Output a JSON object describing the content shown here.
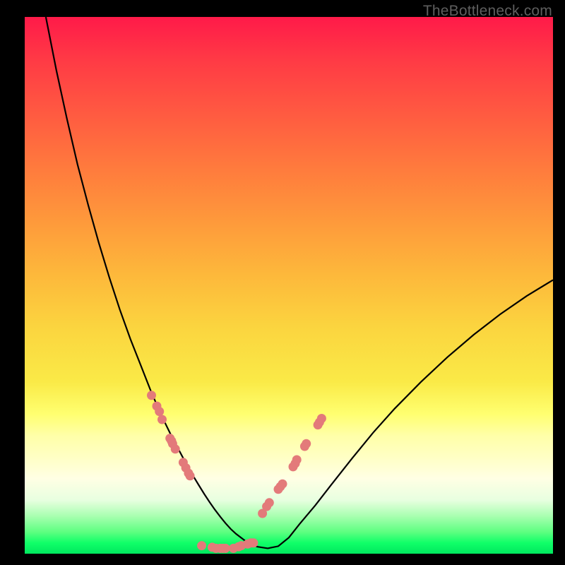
{
  "watermark": "TheBottleneck.com",
  "colors": {
    "gradient_top": "#ff1a49",
    "gradient_mid": "#fbd53f",
    "gradient_bottom": "#00e85e",
    "curve": "#000000",
    "dots": "#e37a7a",
    "frame": "#000000"
  },
  "chart_data": {
    "type": "line",
    "title": "",
    "xlabel": "",
    "ylabel": "",
    "xlim": [
      0,
      100
    ],
    "ylim": [
      0,
      100
    ],
    "x": [
      4,
      6,
      8,
      10,
      12,
      14,
      16,
      18,
      20,
      22,
      24,
      26,
      28,
      30,
      32,
      33,
      34,
      35,
      36,
      37,
      38,
      39,
      40,
      42,
      44,
      46,
      48,
      50,
      52,
      55,
      58,
      62,
      66,
      70,
      75,
      80,
      85,
      90,
      95,
      100
    ],
    "values": [
      100,
      90,
      81,
      72.5,
      65,
      58,
      51.5,
      45.5,
      40,
      35,
      30,
      25.5,
      21.5,
      17.8,
      14.3,
      12.7,
      11.1,
      9.6,
      8.2,
      6.9,
      5.7,
      4.6,
      3.7,
      2.2,
      1.3,
      1,
      1.4,
      3,
      5.5,
      9,
      12.8,
      17.8,
      22.6,
      27,
      32,
      36.6,
      40.8,
      44.6,
      48,
      51
    ],
    "series": [
      {
        "name": "dots_left",
        "x": [
          24,
          25,
          25.5,
          26,
          27.5,
          27.8,
          28,
          28.5,
          30,
          30.5,
          31,
          31.3
        ],
        "y": [
          29.5,
          27.5,
          26.5,
          25,
          21.5,
          21,
          20.5,
          19.5,
          17,
          16,
          15,
          14.5
        ]
      },
      {
        "name": "dots_bottom",
        "x": [
          33.5,
          35.5,
          36.2,
          37,
          37.5,
          38,
          39.5,
          40.5,
          41,
          42.2,
          42.8,
          43.3
        ],
        "y": [
          1.5,
          1.2,
          1,
          1,
          1,
          1,
          1,
          1.3,
          1.5,
          1.8,
          2,
          2
        ]
      },
      {
        "name": "dots_right",
        "x": [
          45,
          45.8,
          46.3,
          48,
          48.4,
          48.8,
          50.8,
          51.2,
          51.5,
          53,
          53.3,
          55.5,
          55.8,
          56.2
        ],
        "y": [
          7.5,
          8.8,
          9.5,
          12,
          12.5,
          13,
          16.2,
          16.8,
          17.5,
          20,
          20.5,
          24,
          24.5,
          25.2
        ]
      }
    ]
  }
}
